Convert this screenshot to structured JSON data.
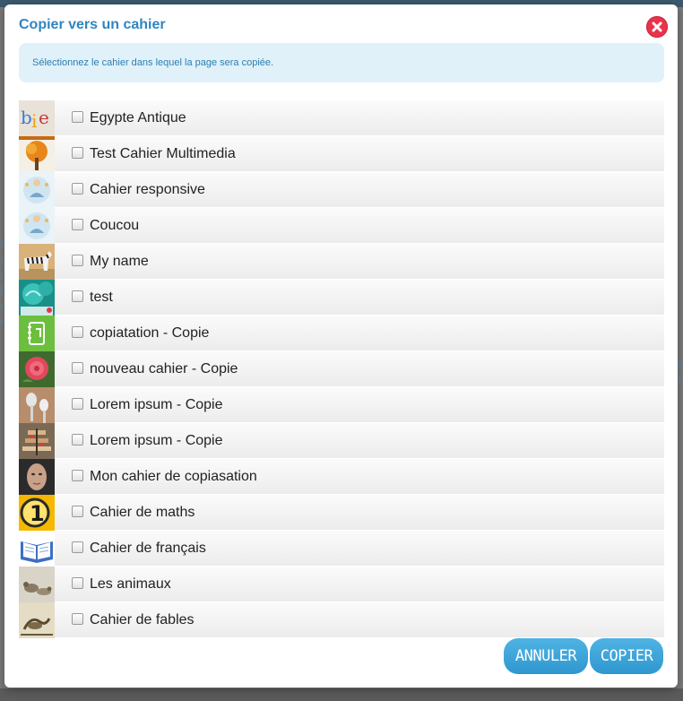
{
  "dialog": {
    "title": "Copier vers un cahier",
    "info": "Sélectionnez le cahier dans lequel la page sera copiée.",
    "close_icon": "close-icon"
  },
  "notebooks": [
    {
      "label": "Egypte Antique",
      "thumbnail": "colored-letters-thumbnail"
    },
    {
      "label": "Test Cahier Multimedia",
      "thumbnail": "autumn-tree-thumbnail"
    },
    {
      "label": "Cahier responsive",
      "thumbnail": "meditation-figure-thumbnail"
    },
    {
      "label": "Coucou",
      "thumbnail": "meditation-figure-thumbnail"
    },
    {
      "label": "My name",
      "thumbnail": "zebra-thumbnail"
    },
    {
      "label": "test",
      "thumbnail": "teal-cupcake-thumbnail"
    },
    {
      "label": "copiatation - Copie",
      "thumbnail": "green-notebook-icon-thumbnail"
    },
    {
      "label": "nouveau cahier - Copie",
      "thumbnail": "red-rose-thumbnail"
    },
    {
      "label": "Lorem ipsum - Copie",
      "thumbnail": "spoons-thumbnail"
    },
    {
      "label": "Lorem ipsum - Copie",
      "thumbnail": "cake-stand-thumbnail"
    },
    {
      "label": "Mon cahier de copiasation",
      "thumbnail": "face-portrait-thumbnail"
    },
    {
      "label": "Cahier de maths",
      "thumbnail": "number-one-thumbnail"
    },
    {
      "label": "Cahier de français",
      "thumbnail": "open-book-thumbnail"
    },
    {
      "label": "Les animaux",
      "thumbnail": "birds-thumbnail"
    },
    {
      "label": "Cahier de fables",
      "thumbnail": "fable-illustration-thumbnail"
    }
  ],
  "buttons": {
    "cancel": "ANNULER",
    "copy": "COPIER"
  },
  "colors": {
    "title": "#2e86c1",
    "close": "#e8334a",
    "info_bg": "#e1f1fa",
    "button": "#3aa6dc"
  }
}
